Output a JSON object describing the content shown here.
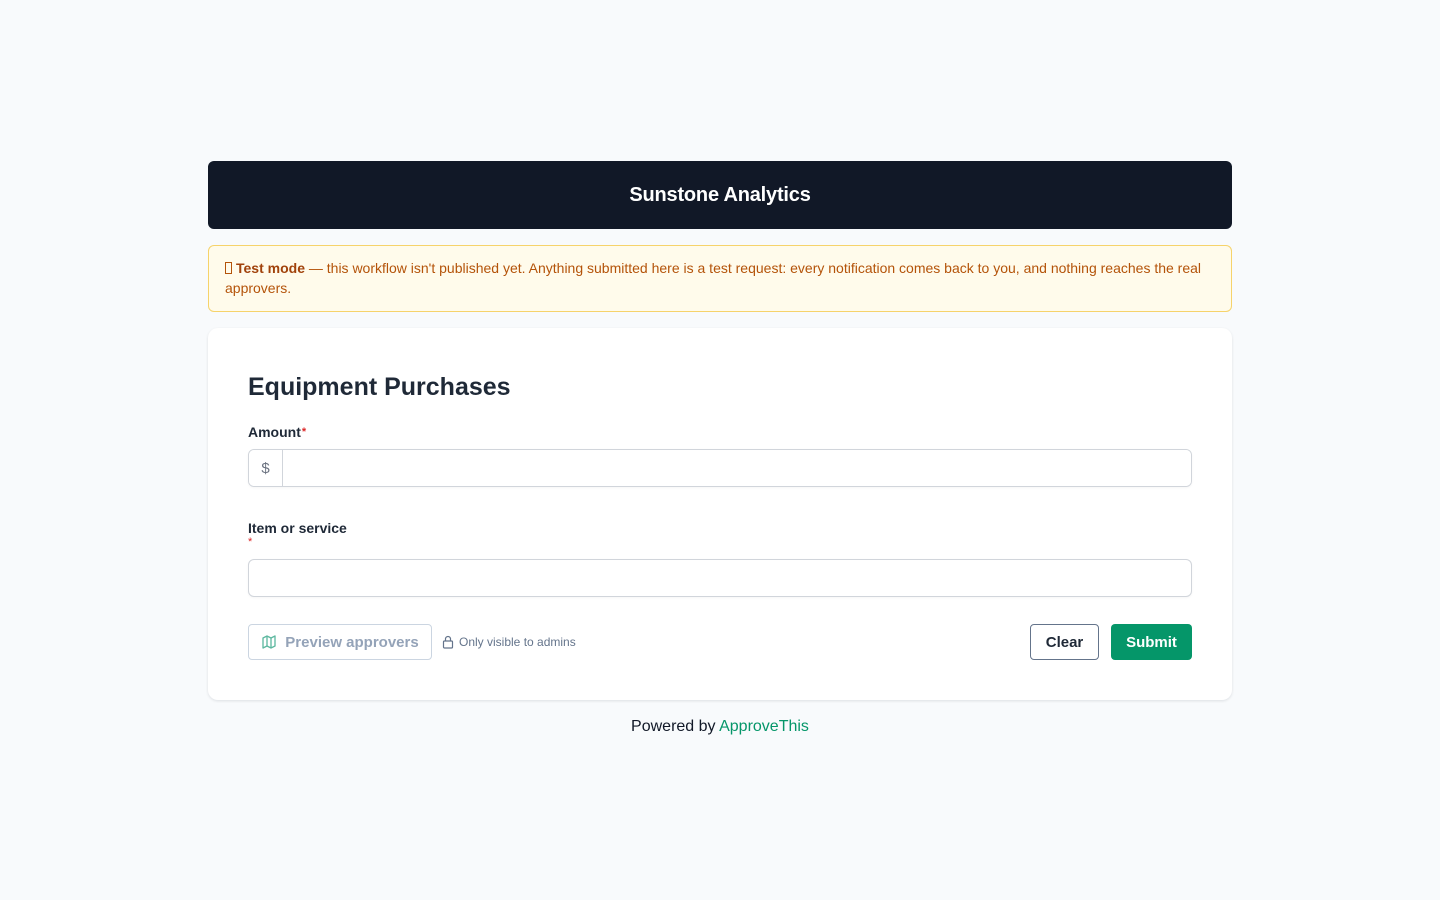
{
  "header": {
    "title": "Sunstone Analytics"
  },
  "banner": {
    "icon": "warning-icon",
    "strong": "Test mode",
    "text": " — this workflow isn't published yet. Anything submitted here is a test request: every notification comes back to you, and nothing reaches the real approvers."
  },
  "form": {
    "title": "Equipment Purchases",
    "fields": [
      {
        "label": "Amount",
        "required_mark": "*",
        "prefix": "$",
        "value": "",
        "placeholder": ""
      },
      {
        "label": "Item or service",
        "required_mark": "*",
        "value": "",
        "placeholder": ""
      }
    ]
  },
  "actions": {
    "preview_label": "Preview approvers",
    "preview_icon": "map-icon",
    "admin_note": "Only visible to admins",
    "admin_icon": "lock-icon",
    "clear_label": "Clear",
    "submit_label": "Submit"
  },
  "footer": {
    "prefix": "Powered by ",
    "link_text": "ApproveThis"
  },
  "colors": {
    "header_bg": "#111827",
    "accent": "#059669",
    "banner_bg": "#fffbeb",
    "banner_text": "#b45309",
    "required": "#dc2626"
  }
}
